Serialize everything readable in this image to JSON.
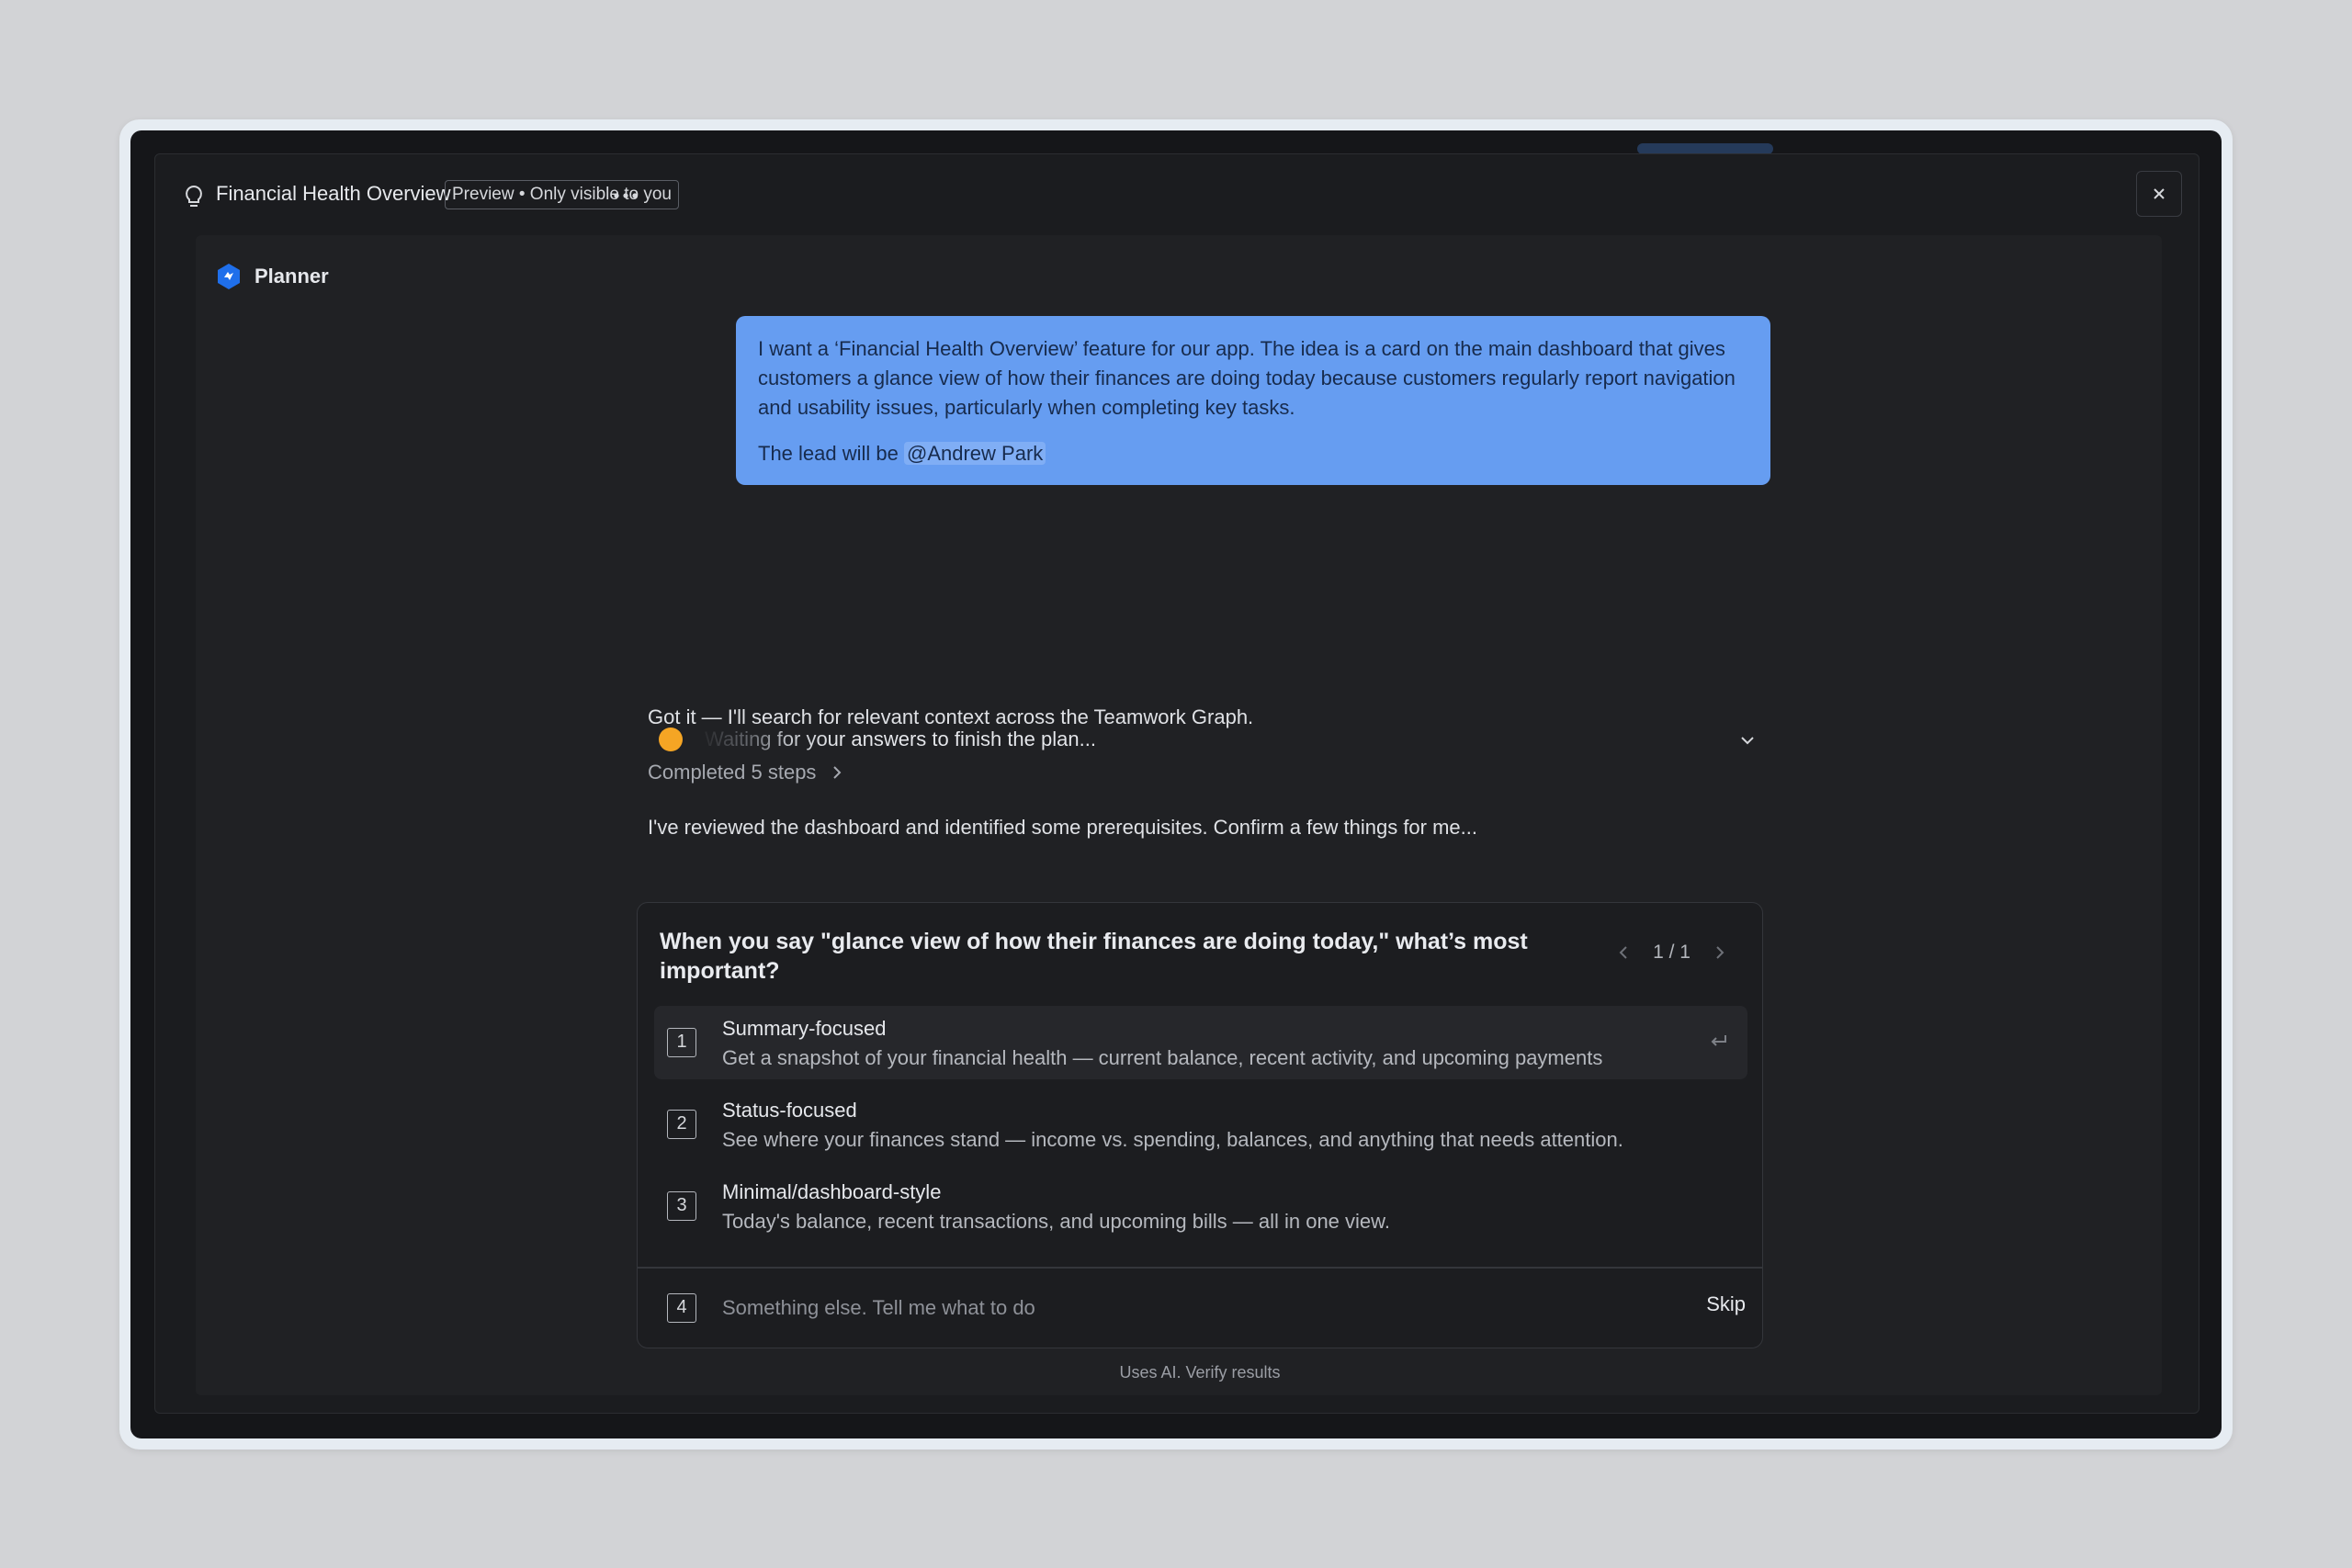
{
  "header": {
    "title": "Financial Health Overview",
    "badge": "Preview • Only visible to you"
  },
  "agent": {
    "name": "Planner"
  },
  "user_message": {
    "text": "I want a ‘Financial Health Overview’ feature for our app. The idea is a card on the main dashboard that gives customers a glance view of how their finances are doing today because customers regularly report navigation and usability issues, particularly when completing key tasks.",
    "lead_prefix": "The lead will be",
    "mention": "@Andrew Park"
  },
  "assistant": {
    "intro": "Got it — I'll search for relevant context across the Teamwork Graph.",
    "steps": "Completed 5 steps",
    "reviewed": "I've reviewed the dashboard and identified some prerequisites. Confirm a few things for me...",
    "waiting": "Waiting for your answers to finish the plan..."
  },
  "question": {
    "text": "When you say \"glance view of how their finances are doing today,\" what’s most important?",
    "pager": "1 / 1",
    "options": [
      {
        "num": "1",
        "title": "Summary-focused",
        "desc": "Get a snapshot of your financial health — current balance, recent activity, and upcoming payments"
      },
      {
        "num": "2",
        "title": "Status-focused",
        "desc": "See where your finances stand — income vs. spending, balances, and anything that needs attention."
      },
      {
        "num": "3",
        "title": "Minimal/dashboard-style",
        "desc": "Today's balance, recent transactions, and upcoming bills — all in one view."
      }
    ],
    "other_num": "4",
    "other_placeholder": "Something else. Tell me what to do",
    "skip": "Skip"
  },
  "disclaimer": "Uses AI. Verify results",
  "colors": {
    "bubble": "#669df1",
    "status_dot": "#f5a524",
    "planner_icon": "#1f6feb"
  }
}
